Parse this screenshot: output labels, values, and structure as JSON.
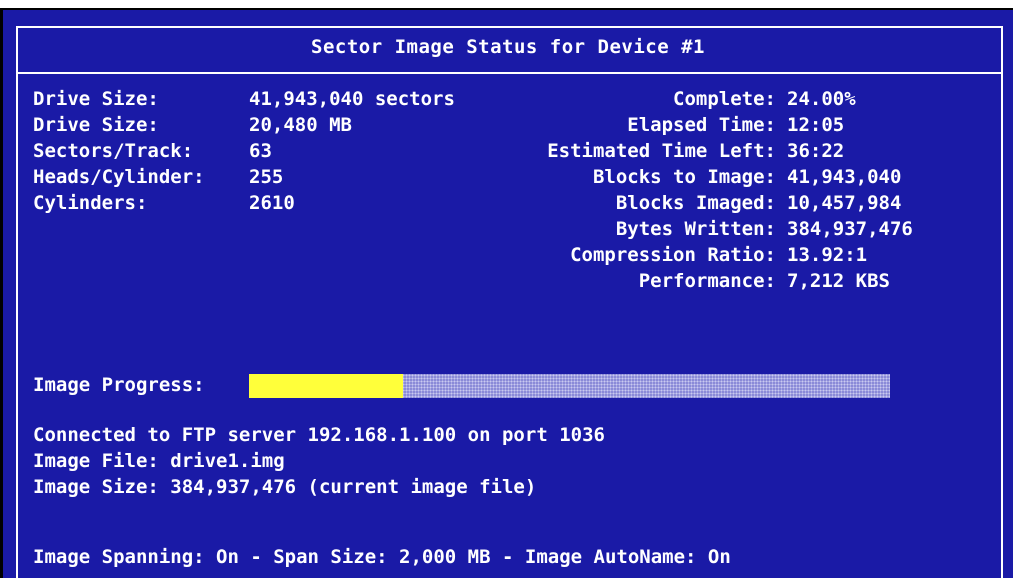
{
  "window": {
    "title": "Sector Image Status for Device #1"
  },
  "drive_info": [
    {
      "label": "Drive Size:",
      "value": "41,943,040 sectors"
    },
    {
      "label": "Drive Size:",
      "value": "20,480 MB"
    },
    {
      "label": "Sectors/Track:",
      "value": "63"
    },
    {
      "label": "Heads/Cylinder:",
      "value": "255"
    },
    {
      "label": "Cylinders:",
      "value": "2610"
    }
  ],
  "status_info": [
    {
      "label": "Complete:",
      "value": "24.00%"
    },
    {
      "label": "Elapsed Time:",
      "value": "12:05"
    },
    {
      "label": "Estimated Time Left:",
      "value": "36:22"
    },
    {
      "label": "Blocks to Image:",
      "value": "41,943,040"
    },
    {
      "label": "Blocks Imaged:",
      "value": "10,457,984"
    },
    {
      "label": "Bytes Written:",
      "value": "384,937,476"
    },
    {
      "label": "Compression Ratio:",
      "value": "13.92:1"
    },
    {
      "label": "Performance:",
      "value": "7,212 KBS"
    }
  ],
  "progress": {
    "label": "Image Progress:",
    "fraction": 0.24
  },
  "messages": {
    "connection": "Connected to FTP server 192.168.1.100 on port 1036",
    "image_file": "Image File: drive1.img",
    "image_size": "Image Size: 384,937,476 (current image file)",
    "spanning": "Image Spanning: On - Span Size: 2,000 MB - Image AutoName: On"
  },
  "colors": {
    "background": "#1a1aa6",
    "text": "#ffffff",
    "progress_fill": "#ffff3a",
    "progress_track": "#8a8ad8"
  }
}
